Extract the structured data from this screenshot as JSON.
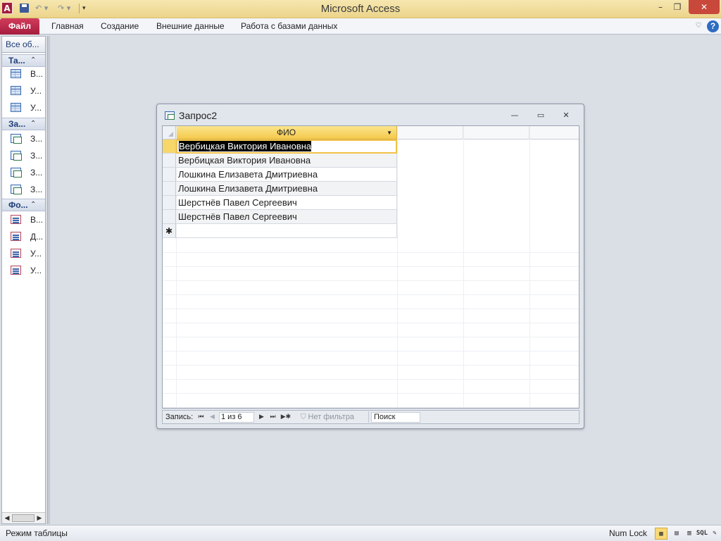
{
  "app": {
    "title": "Microsoft Access",
    "icon_letter": "A"
  },
  "qat": {
    "save_icon": "save-icon",
    "undo_glyph": "↶ ▾",
    "redo_glyph": "↷ ▾",
    "customize_glyph": "▾"
  },
  "window_controls": {
    "minimize": "–",
    "maximize": "❐",
    "close": "✕"
  },
  "ribbon": {
    "file_tab": "Файл",
    "tabs": [
      "Главная",
      "Создание",
      "Внешние данные",
      "Работа с базами данных"
    ],
    "collapse_glyph": "♡",
    "help_glyph": "?"
  },
  "nav": {
    "header": "Все об...",
    "groups": [
      {
        "label": "Та...",
        "chevron": "⌃",
        "type": "table",
        "items": [
          "В...",
          "У...",
          "У..."
        ]
      },
      {
        "label": "За...",
        "chevron": "⌃",
        "type": "query",
        "items": [
          "З...",
          "З...",
          "З...",
          "З..."
        ]
      },
      {
        "label": "Фо...",
        "chevron": "⌃",
        "type": "form",
        "items": [
          "В...",
          "Д...",
          "У...",
          "У..."
        ]
      }
    ],
    "scroll_left": "◀",
    "scroll_thumb": "|||",
    "scroll_right": "▶"
  },
  "query_window": {
    "title": "Запрос2",
    "minimize": "—",
    "restore": "▭",
    "close": "✕"
  },
  "datasheet": {
    "column_header": "ФИО",
    "filter_arrow": "▼",
    "rows": [
      "Вербицкая Виктория Ивановна",
      "Вербицкая Виктория Ивановна",
      "Лошкина Елизавета Дмитриевна",
      "Лошкина Елизавета Дмитриевна",
      "Шерстнёв Павел Сергеевич",
      "Шерстнёв Павел Сергеевич"
    ],
    "new_row_marker": "✱"
  },
  "record_nav": {
    "label": "Запись:",
    "first": "⏮",
    "prev": "◀",
    "current": "1 из 6",
    "next": "▶",
    "last": "⏭",
    "new": "▶✱",
    "filter_text": "Нет фильтра",
    "filter_icon": "⛉",
    "search_placeholder": "Поиск"
  },
  "status": {
    "mode": "Режим таблицы",
    "numlock": "Num Lock",
    "views": {
      "datasheet": "▦",
      "pivot": "▤",
      "chart": "▥",
      "sql": "SQL",
      "design": "✎"
    }
  },
  "colors": {
    "file_tab": "#a51d3e",
    "title_bar": "#ecd48a",
    "active_header": "#f5c94c",
    "workspace": "#dadfe5"
  }
}
